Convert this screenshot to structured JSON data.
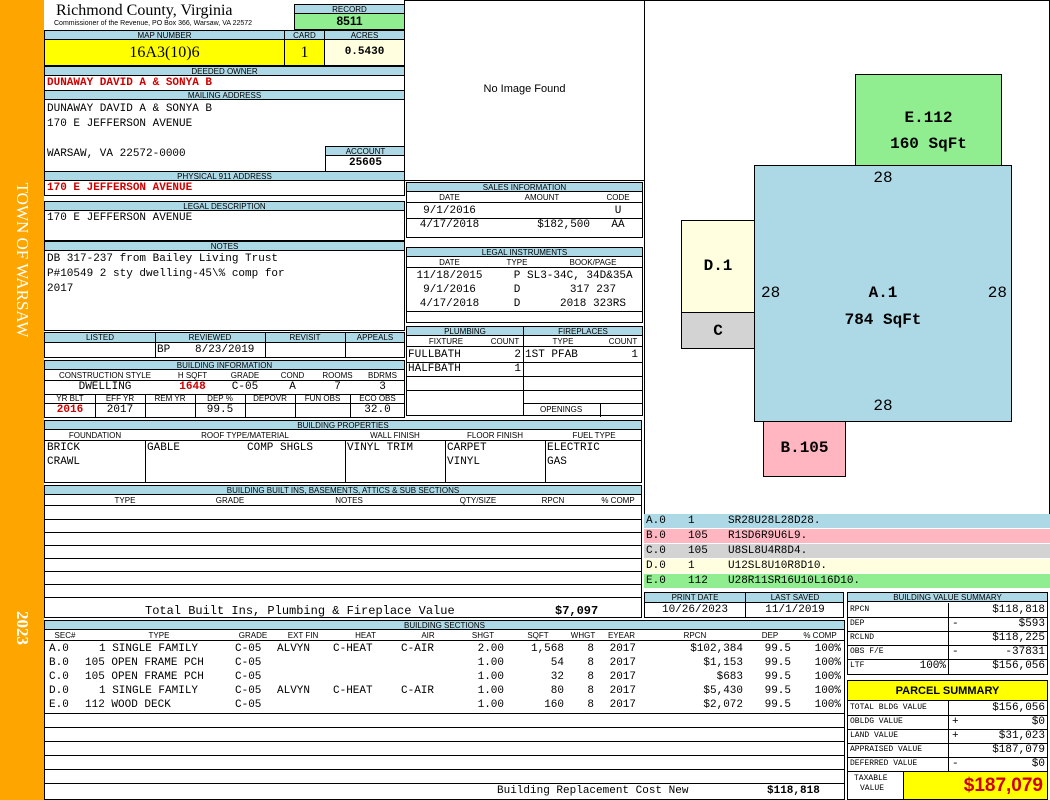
{
  "sidebar": {
    "town": "TOWN OF WARSAW",
    "year": "2023"
  },
  "header": {
    "county": "Richmond County, Virginia",
    "commissioner": "Commissioner of the Revenue, PO Box 366, Warsaw, VA 22572",
    "record_label": "RECORD",
    "record": "8511",
    "map_label": "MAP NUMBER",
    "map_number": "16A3(10)6",
    "card_label": "CARD",
    "card": "1",
    "acres_label": "ACRES",
    "acres": "0.5430"
  },
  "owner": {
    "deeded_label": "DEEDED OWNER",
    "deeded": "DUNAWAY DAVID A & SONYA B",
    "mailing_label": "MAILING ADDRESS",
    "mailing_lines": [
      "DUNAWAY DAVID A & SONYA B",
      "170 E JEFFERSON AVENUE",
      "WARSAW, VA 22572-0000"
    ],
    "account_label": "ACCOUNT",
    "account": "25605",
    "physical_label": "PHYSICAL 911 ADDRESS",
    "physical": "170 E JEFFERSON AVENUE",
    "legal_label": "LEGAL DESCRIPTION",
    "legal": "170 E JEFFERSON AVENUE",
    "notes_label": "NOTES",
    "notes_lines": [
      "DB 317-237 from Bailey Living Trust",
      "P#10549 2 sty dwelling-45\\% comp for",
      "2017"
    ]
  },
  "image": {
    "text": "No Image Found"
  },
  "sales": {
    "title": "SALES INFORMATION",
    "headers": [
      "DATE",
      "AMOUNT",
      "CODE"
    ],
    "rows": [
      [
        "9/1/2016",
        "",
        "U"
      ],
      [
        "4/17/2018",
        "$182,500",
        "AA"
      ]
    ]
  },
  "legal_instruments": {
    "title": "LEGAL INSTRUMENTS",
    "headers": [
      "DATE",
      "TYPE",
      "BOOK/PAGE"
    ],
    "rows": [
      [
        "11/18/2015",
        "P",
        "SL3-34C, 34D&35A"
      ],
      [
        "9/1/2016",
        "D",
        "317 237"
      ],
      [
        "4/17/2018",
        "D",
        "2018 323RS"
      ]
    ]
  },
  "plumbing": {
    "title": "PLUMBING",
    "headers": [
      "FIXTURE",
      "COUNT"
    ],
    "rows": [
      [
        "FULLBATH",
        "2"
      ],
      [
        "HALFBATH",
        "1"
      ]
    ]
  },
  "fireplaces": {
    "title": "FIREPLACES",
    "headers": [
      "TYPE",
      "COUNT"
    ],
    "rows": [
      [
        "1ST PFAB",
        "1"
      ]
    ],
    "openings_label": "OPENINGS"
  },
  "review": {
    "headers": [
      "LISTED",
      "REVIEWED",
      "REVISIT",
      "APPEALS"
    ],
    "reviewed_code": "BP",
    "reviewed_date": "8/23/2019"
  },
  "building_info": {
    "title": "BUILDING INFORMATION",
    "headers1": [
      "CONSTRUCTION STYLE",
      "H SQFT",
      "GRADE",
      "COND",
      "ROOMS",
      "BDRMS"
    ],
    "values1": [
      "DWELLING",
      "1648",
      "C-05",
      "A",
      "7",
      "3"
    ],
    "headers2": [
      "YR BLT",
      "EFF YR",
      "REM YR",
      "DEP %",
      "DEPOVR",
      "FUN OBS",
      "ECO OBS"
    ],
    "values2": [
      "2016",
      "2017",
      "",
      "99.5",
      "",
      "",
      "32.0"
    ]
  },
  "properties": {
    "title": "BUILDING PROPERTIES",
    "headers": [
      "FOUNDATION",
      "ROOF TYPE/MATERIAL",
      "WALL FINISH",
      "FLOOR FINISH",
      "FUEL TYPE"
    ],
    "foundation": [
      "BRICK",
      "CRAWL"
    ],
    "roof_type": "GABLE",
    "roof_material": "COMP SHGLS",
    "wall": [
      "VINYL TRIM"
    ],
    "floor": [
      "CARPET",
      "VINYL"
    ],
    "fuel": [
      "ELECTRIC",
      "GAS"
    ]
  },
  "builtins": {
    "title": "BUILDING BUILT INS, BASEMENTS, ATTICS & SUB SECTIONS",
    "headers": [
      "TYPE",
      "GRADE",
      "NOTES",
      "QTY/SIZE",
      "RPCN",
      "% COMP"
    ],
    "total_label": "Total Built Ins, Plumbing & Fireplace Value",
    "total_value": "$7,097"
  },
  "sketch": {
    "areas": [
      {
        "code": "E.112",
        "sqft": "160 SqFt"
      },
      {
        "code": "D.1",
        "sqft": ""
      },
      {
        "code": "C",
        "sqft": ""
      },
      {
        "code": "A.1",
        "sqft": "784 SqFt"
      },
      {
        "code": "B.105",
        "sqft": ""
      }
    ],
    "dims": [
      "28",
      "28",
      "28",
      "28"
    ]
  },
  "legend": [
    {
      "code": "A.0",
      "num": "1",
      "desc": "SR28U28L28D28.",
      "color": "#add8e6"
    },
    {
      "code": "B.0",
      "num": "105",
      "desc": "R1SD6R9U6L9.",
      "color": "#ffb6c1"
    },
    {
      "code": "C.0",
      "num": "105",
      "desc": "U8SL8U4R8D4.",
      "color": "#d3d3d3"
    },
    {
      "code": "D.0",
      "num": "1",
      "desc": "U12SL8U10R8D10.",
      "color": "#ffffe0"
    },
    {
      "code": "E.0",
      "num": "112",
      "desc": "U28R11SR16U10L16D10.",
      "color": "#90ee90"
    }
  ],
  "print": {
    "print_label": "PRINT DATE",
    "print_date": "10/26/2023",
    "saved_label": "LAST SAVED",
    "saved_date": "11/1/2019"
  },
  "sections": {
    "title": "BUILDING SECTIONS",
    "headers": [
      "SEC#",
      "TYPE",
      "GRADE",
      "EXT FIN",
      "HEAT",
      "AIR",
      "SHGT",
      "SQFT",
      "WHGT",
      "EYEAR",
      "RPCN",
      "DEP",
      "% COMP"
    ],
    "rows": [
      [
        "A.0",
        "1 SINGLE FAMILY",
        "C-05",
        "ALVYN",
        "C-HEAT",
        "C-AIR",
        "2.00",
        "1,568",
        "8",
        "2017",
        "$102,384",
        "99.5",
        "100%"
      ],
      [
        "B.0",
        "105 OPEN FRAME PCH",
        "C-05",
        "",
        "",
        "",
        "1.00",
        "54",
        "8",
        "2017",
        "$1,153",
        "99.5",
        "100%"
      ],
      [
        "C.0",
        "105 OPEN FRAME PCH",
        "C-05",
        "",
        "",
        "",
        "1.00",
        "32",
        "8",
        "2017",
        "$683",
        "99.5",
        "100%"
      ],
      [
        "D.0",
        "1 SINGLE FAMILY",
        "C-05",
        "ALVYN",
        "C-HEAT",
        "C-AIR",
        "1.00",
        "80",
        "8",
        "2017",
        "$5,430",
        "99.5",
        "100%"
      ],
      [
        "E.0",
        "112 WOOD DECK",
        "C-05",
        "",
        "",
        "",
        "1.00",
        "160",
        "8",
        "2017",
        "$2,072",
        "99.5",
        "100%"
      ]
    ],
    "replacement_label": "Building Replacement Cost New",
    "replacement_value": "$118,818"
  },
  "value_summary": {
    "title": "BUILDING VALUE SUMMARY",
    "rows": [
      {
        "label": "RPCN",
        "sign": "",
        "pct": "",
        "value": "$118,818"
      },
      {
        "label": "DEP",
        "sign": "-",
        "pct": "",
        "value": "$593"
      },
      {
        "label": "RCLND",
        "sign": "",
        "pct": "",
        "value": "$118,225"
      },
      {
        "label": "OBS F/E",
        "sign": "-",
        "pct": "",
        "value": "-37831"
      },
      {
        "label": "LTF",
        "sign": "",
        "pct": "100%",
        "value": "$156,056"
      }
    ]
  },
  "parcel": {
    "title": "PARCEL SUMMARY",
    "rows": [
      {
        "label": "TOTAL BLDG VALUE",
        "sign": "",
        "value": "$156,056"
      },
      {
        "label": "OBLDG VALUE",
        "sign": "+",
        "value": "$0"
      },
      {
        "label": "LAND VALUE",
        "sign": "+",
        "value": "$31,023"
      },
      {
        "label": "APPRAISED VALUE",
        "sign": "",
        "value": "$187,079"
      },
      {
        "label": "DEFERRED VALUE",
        "sign": "-",
        "value": "$0"
      }
    ],
    "taxable_label1": "TAXABLE",
    "taxable_label2": "VALUE",
    "taxable": "$187,079"
  }
}
